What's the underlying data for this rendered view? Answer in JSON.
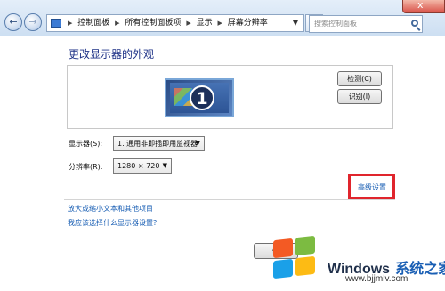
{
  "window": {
    "close_glyph": "x",
    "nav": {
      "back_glyph": "←",
      "forward_glyph": "→"
    },
    "breadcrumb": [
      {
        "label": "控制面板"
      },
      {
        "label": "所有控制面板项"
      },
      {
        "label": "显示"
      },
      {
        "label": "屏幕分辨率"
      }
    ],
    "breadcrumb_separator": "▶",
    "refresh_glyph": "↻",
    "search_placeholder": "搜索控制面板"
  },
  "main": {
    "heading": "更改显示器的外观",
    "monitor_number": "1",
    "detect_button": "检测(C)",
    "identify_button": "识别(I)",
    "display_label": "显示器(S):",
    "display_value": "1. 通用非即插即用监视器",
    "resolution_label": "分辨率(R):",
    "resolution_value": "1280 × 720",
    "dropdown_glyph": "▼",
    "advanced_link": "高级设置",
    "links": [
      "放大或缩小文本和其他项目",
      "我应该选择什么显示器设置?"
    ],
    "ok_button": "确"
  },
  "watermark": {
    "brand": "Windows",
    "brand_zh": "系统之家",
    "url": "www.bjjmlv.com"
  },
  "colors": {
    "link": "#1a5fb4",
    "heading": "#1e3287",
    "highlight_box": "#e0252d"
  }
}
